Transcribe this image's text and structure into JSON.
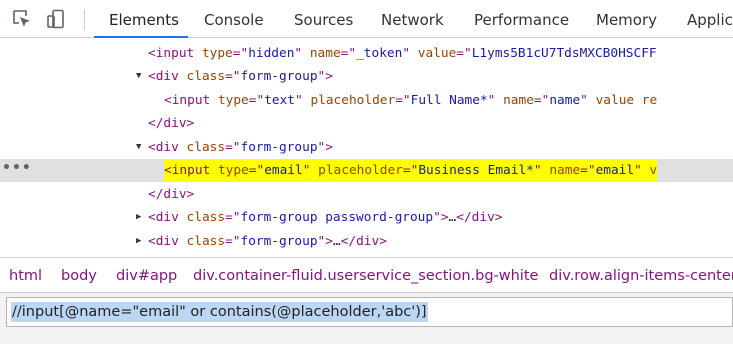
{
  "toolbar": {
    "inspect_icon": "inspect-element-icon",
    "device_icon": "device-toolbar-icon",
    "tabs": [
      {
        "label": "Elements",
        "active": true
      },
      {
        "label": "Console"
      },
      {
        "label": "Sources"
      },
      {
        "label": "Network"
      },
      {
        "label": "Performance"
      },
      {
        "label": "Memory"
      },
      {
        "label": "Applic"
      }
    ],
    "accent_color": "#1a73e8"
  },
  "tree": {
    "lines": [
      {
        "tag_open": "<input ",
        "attrs": [
          {
            "name": "type",
            "value": "hidden"
          },
          {
            "name": "name",
            "value": "_token"
          },
          {
            "name": "value",
            "value": "L1yms5B1cU7TdsMXCB0HSCFF"
          }
        ]
      },
      {
        "tag": "<div ",
        "attr_name": "class",
        "attr_value": "form-group",
        "tag_close": ">"
      },
      {
        "tag_open": "<input ",
        "attrs": [
          {
            "name": "type",
            "value": "text"
          },
          {
            "name": "placeholder",
            "value": "Full Name*"
          },
          {
            "name": "name",
            "value": "name"
          }
        ],
        "tail": "value re"
      },
      {
        "tag": "</div>"
      },
      {
        "tag": "<div ",
        "attr_name": "class",
        "attr_value": "form-group",
        "tag_close": ">"
      },
      {
        "tag_open": "<input ",
        "attrs": [
          {
            "name": "type",
            "value": "email"
          },
          {
            "name": "placeholder",
            "value": "Business Email*"
          },
          {
            "name": "name",
            "value": "email"
          }
        ],
        "tail": "v"
      },
      {
        "tag": "</div>"
      },
      {
        "tag": "<div ",
        "attr_name": "class",
        "attr_value": "form-group password-group",
        "tag_close": ">",
        "ellipsis": "…",
        "close": "</div>"
      },
      {
        "tag": "<div ",
        "attr_name": "class",
        "attr_value": "form-group",
        "tag_close": ">",
        "ellipsis": "…",
        "close": "</div>"
      }
    ],
    "selected_marker": "•••",
    "highlight_color": "#ffff00"
  },
  "breadcrumb": [
    "html",
    "body",
    "div#app",
    "div.container-fluid.userservice_section.bg-white",
    "div.row.align-items-center"
  ],
  "search": {
    "value": "//input[@name=\"email\" or contains(@placeholder,'abc')]"
  }
}
